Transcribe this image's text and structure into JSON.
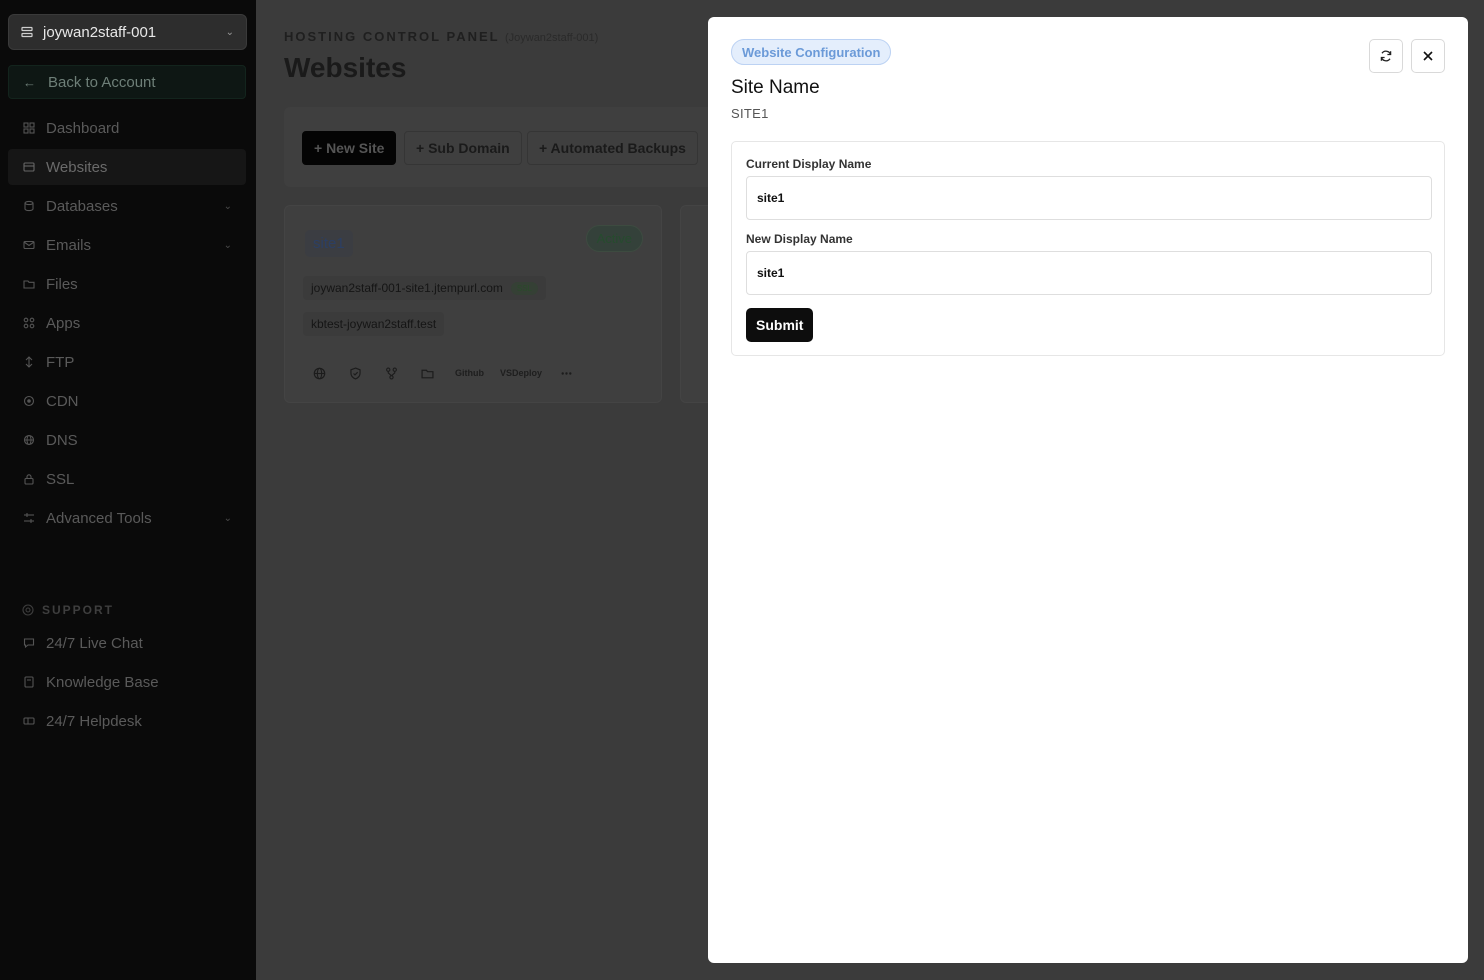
{
  "sidebar": {
    "account": "joywan2staff-001",
    "back_label": "Back to Account",
    "items": [
      {
        "label": "Dashboard",
        "icon": "dashboard-icon",
        "chevron": false
      },
      {
        "label": "Websites",
        "icon": "websites-icon",
        "chevron": false
      },
      {
        "label": "Databases",
        "icon": "database-icon",
        "chevron": true
      },
      {
        "label": "Emails",
        "icon": "mail-icon",
        "chevron": true
      },
      {
        "label": "Files",
        "icon": "folder-icon",
        "chevron": false
      },
      {
        "label": "Apps",
        "icon": "apps-icon",
        "chevron": false
      },
      {
        "label": "FTP",
        "icon": "ftp-icon",
        "chevron": false
      },
      {
        "label": "CDN",
        "icon": "cdn-icon",
        "chevron": false
      },
      {
        "label": "DNS",
        "icon": "dns-icon",
        "chevron": false
      },
      {
        "label": "SSL",
        "icon": "lock-icon",
        "chevron": false
      },
      {
        "label": "Advanced Tools",
        "icon": "tools-icon",
        "chevron": true
      }
    ],
    "support_label": "SUPPORT",
    "support_items": [
      {
        "label": "24/7 Live Chat",
        "icon": "chat-icon"
      },
      {
        "label": "Knowledge Base",
        "icon": "book-icon"
      },
      {
        "label": "24/7 Helpdesk",
        "icon": "ticket-icon"
      }
    ]
  },
  "main": {
    "kicker": "HOSTING CONTROL PANEL",
    "kicker_account": "(Joywan2staff-001)",
    "title": "Websites",
    "toolbar": {
      "new_site": "+ New Site",
      "sub_domain": "+ Sub Domain",
      "automated_backups": "+ Automated Backups"
    },
    "site_card": {
      "name": "site1",
      "status": "Active",
      "domains": [
        {
          "host": "joywan2staff-001-site1.jtempurl.com",
          "ssl": "SSL"
        },
        {
          "host": "kbtest-joywan2staff.test",
          "ssl": ""
        }
      ],
      "action_github": "Github",
      "action_vsdeploy": "VSDeploy"
    }
  },
  "modal": {
    "badge": "Website Configuration",
    "title": "Site Name",
    "subtitle": "SITE1",
    "current_label": "Current Display Name",
    "current_value": "site1",
    "new_label": "New Display Name",
    "new_value": "site1",
    "submit_label": "Submit"
  }
}
